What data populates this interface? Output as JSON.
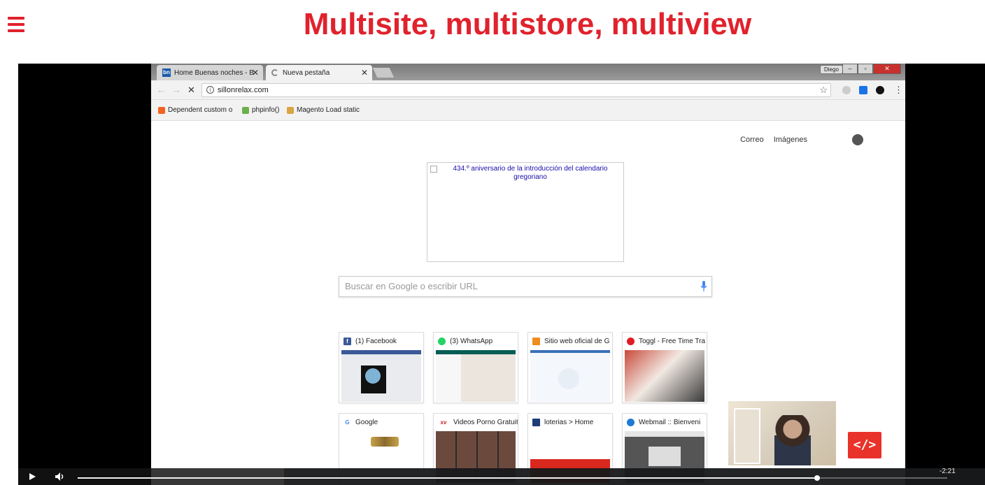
{
  "header": {
    "menu_icon": "hamburger-icon",
    "title": "Multisite, multistore, multiview"
  },
  "browser": {
    "tabs": [
      {
        "favicon": "bn",
        "label": "Home Buenas noches - B"
      },
      {
        "label": "Nueva pestaña"
      }
    ],
    "window_user": "Diego",
    "url": "sillonrelax.com",
    "bookmarks": [
      {
        "icon": "magento-icon",
        "label": "Dependent custom o"
      },
      {
        "icon": "php-icon",
        "label": "phpinfo()"
      },
      {
        "icon": "magento-load-icon",
        "label": "Magento Load static"
      }
    ],
    "ntp": {
      "links": [
        "Correo",
        "Imágenes"
      ],
      "doodle_alt": "434.º aniversario de la introducción del calendario gregoriano",
      "search_placeholder": "Buscar en Google o escribir URL",
      "tiles": [
        {
          "icon": "facebook-icon",
          "color": "#3b5998",
          "glyph": "f",
          "label": "(1) Facebook"
        },
        {
          "icon": "whatsapp-icon",
          "color": "#25d366",
          "glyph": "w",
          "label": "(3) WhatsApp"
        },
        {
          "icon": "orange-site-icon",
          "color": "#f08c1e",
          "glyph": "",
          "label": "Sitio web oficial de G"
        },
        {
          "icon": "toggl-icon",
          "color": "#e01b22",
          "glyph": "t",
          "label": "Toggl - Free Time Tra"
        },
        {
          "icon": "google-icon",
          "color": "#4285f4",
          "glyph": "G",
          "label": "Google"
        },
        {
          "icon": "xv-icon",
          "color": "#c22",
          "glyph": "xv",
          "label": "Videos Porno Gratuit"
        },
        {
          "icon": "loterias-icon",
          "color": "#1d3c78",
          "glyph": "",
          "label": "loterias > Home"
        },
        {
          "icon": "webmail-icon",
          "color": "#1c7bd4",
          "glyph": "",
          "label": "Webmail :: Bienveni"
        }
      ]
    }
  },
  "video": {
    "progress_fraction": 0.85,
    "time_remaining": "-2:21",
    "badge": "</>"
  },
  "colors": {
    "accent": "#e0222d"
  }
}
